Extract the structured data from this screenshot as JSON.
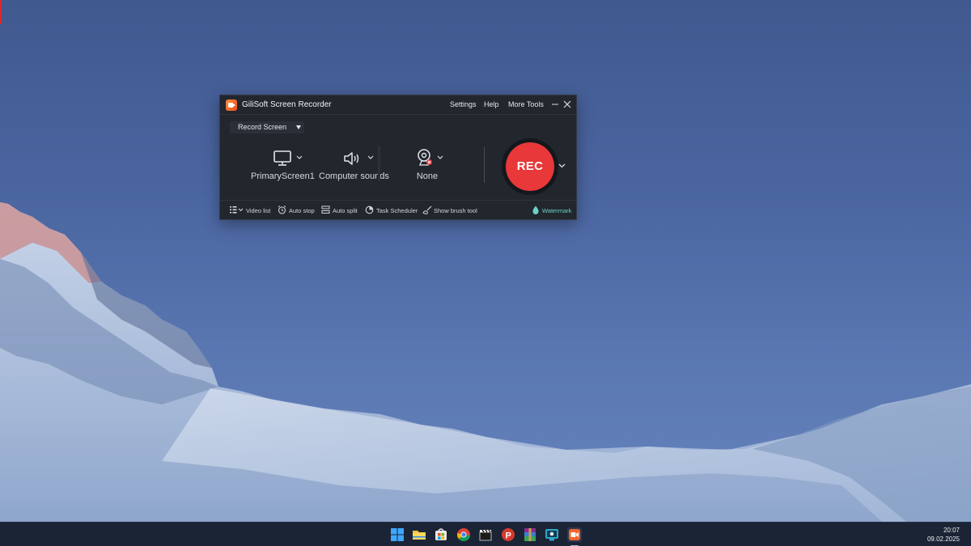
{
  "app": {
    "title": "GiliSoft Screen Recorder",
    "menu": [
      "Settings",
      "Help",
      "More Tools"
    ],
    "mode": "Record Screen",
    "sources": {
      "screen": "PrimaryScreen1",
      "audio": "Computer sounds",
      "webcam": "None"
    },
    "rec_label": "REC",
    "toolbar": {
      "video_list": "Video list",
      "auto_stop": "Auto stop",
      "auto_split": "Auto split",
      "task_scheduler": "Task Scheduler",
      "brush": "Show brush tool",
      "watermark": "Watermark"
    }
  },
  "taskbar": {
    "icons": [
      "windows-start-icon",
      "file-explorer-icon",
      "microsoft-store-icon",
      "chrome-icon",
      "clapperboard-icon",
      "p-app-icon",
      "winrar-icon",
      "screen-app-icon",
      "gilisoft-recorder-icon"
    ],
    "time": "20:07",
    "date": "09.02.2025"
  },
  "colors": {
    "rec": "#e8383a",
    "window_bg": "#22262d",
    "watermark_accent": "#6ad3c8",
    "taskbar_bg": "#1b2434"
  }
}
